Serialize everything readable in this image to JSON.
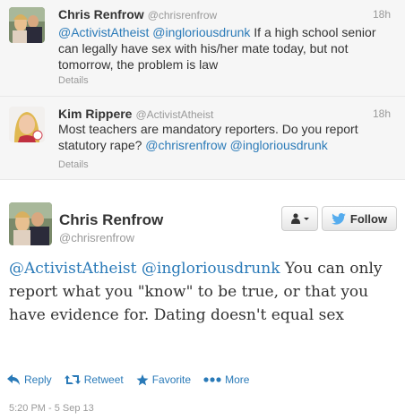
{
  "tweets": [
    {
      "name": "Chris Renfrow",
      "handle": "@chrisrenfrow",
      "time": "18h",
      "text_parts": [
        "@ActivistAtheist",
        " ",
        "@ingloriousdrunk",
        " If a high school senior can legally have sex with his/her mate today, but not tomorrow, the problem is law"
      ],
      "details": "Details"
    },
    {
      "name": "Kim Rippere",
      "handle": "@ActivistAtheist",
      "time": "18h",
      "text_parts": [
        "Most teachers are mandatory reporters.  Do you report statutory rape? ",
        "@chrisrenfrow",
        " ",
        "@ingloriousdrunk"
      ],
      "details": "Details"
    }
  ],
  "main": {
    "name": "Chris Renfrow",
    "handle": "@chrisrenfrow",
    "follow_label": "Follow",
    "text_parts": [
      "@ActivistAtheist",
      " ",
      "@ingloriousdrunk",
      " You can only report what you \"know\" to be true, or that you have evidence for. Dating doesn't equal sex"
    ],
    "actions": {
      "reply": "Reply",
      "retweet": "Retweet",
      "favorite": "Favorite",
      "more": "More"
    },
    "timestamp": "5:20 PM - 5 Sep 13"
  },
  "colors": {
    "link": "#2a7ab8",
    "muted": "#999999",
    "twitter_bird": "#55acee"
  }
}
